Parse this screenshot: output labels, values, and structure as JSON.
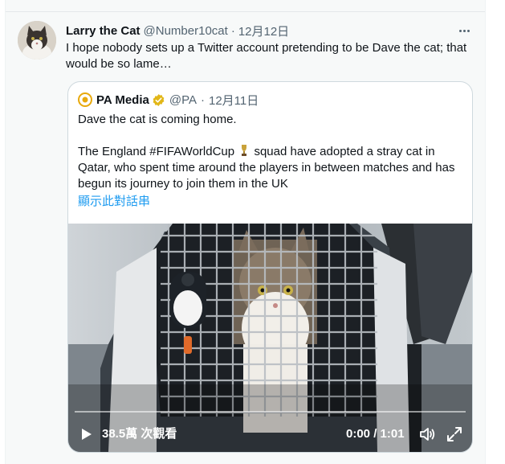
{
  "tweet": {
    "author_name": "Larry the Cat",
    "author_handle": "@Number10cat",
    "separator": "·",
    "date": "12月12日",
    "text": "I hope nobody sets up a Twitter account pretending to be Dave the cat; that\nwould be so lame…",
    "more_icon": "more-horizontal-icon"
  },
  "quoted": {
    "author_name": "PA Media",
    "author_handle": "@PA",
    "separator": "·",
    "date": "12月11日",
    "line1": "Dave the cat is coming home.",
    "line2_prefix": "The England #FIFAWorldCup",
    "line2_suffix": "squad have adopted a stray cat in",
    "line3": "Qatar, who spent time around the players in between matches and has",
    "line4": "begun its journey to join them in the UK",
    "show_thread": "顯示此對話串",
    "verified_icon": "verified-badge-icon",
    "trophy_icon": "trophy-emoji-icon"
  },
  "video": {
    "views": "38.5萬 次觀看",
    "time": "0:00 / 1:01",
    "play_icon": "play-icon",
    "volume_icon": "volume-icon",
    "fullscreen_icon": "fullscreen-icon",
    "progress": 0
  },
  "colors": {
    "link": "#1d9bf0",
    "secondary_text": "#536471",
    "verified_gold": "#e2b719",
    "card_border": "#cfd9de"
  }
}
